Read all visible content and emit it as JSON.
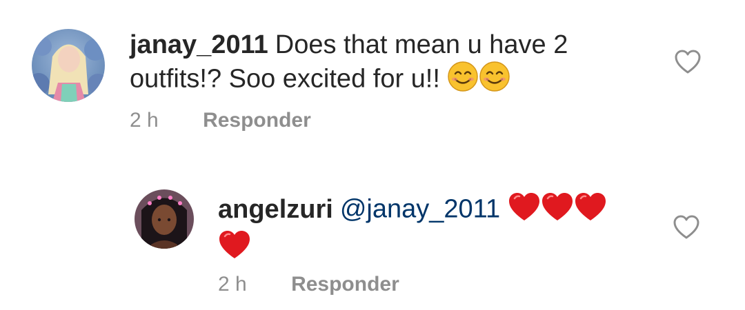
{
  "comments": [
    {
      "username": "janay_2011",
      "text_line1": "Does that mean u have 2",
      "text_line2": "outfits!? Soo excited for u!!",
      "emojis": [
        "smiling-face-with-smiling-eyes",
        "smiling-face-with-smiling-eyes"
      ],
      "time": "2 h",
      "reply_label": "Responder"
    },
    {
      "username": "angelzuri",
      "mention": "@janay_2011",
      "emojis": [
        "red-heart",
        "red-heart",
        "red-heart",
        "red-heart"
      ],
      "time": "2 h",
      "reply_label": "Responder"
    }
  ],
  "colors": {
    "text": "#262626",
    "meta": "#8e8e8e",
    "mention": "#003569",
    "heart": "#e0191f",
    "emoji_face": "#f9c22e"
  }
}
